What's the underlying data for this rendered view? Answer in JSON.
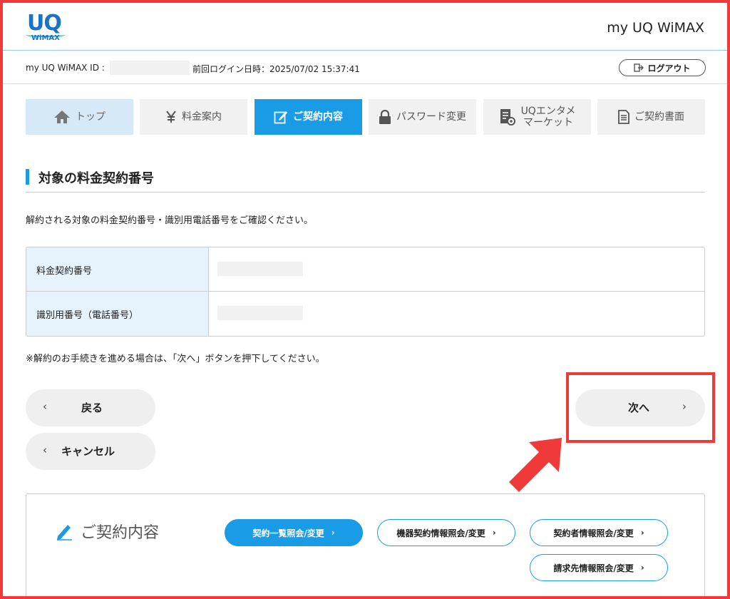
{
  "header": {
    "logo_top": "UQ",
    "logo_bottom": "WiMAX",
    "site_title": "my UQ WiMAX"
  },
  "infobar": {
    "id_label": "my UQ WiMAX ID :",
    "last_login": "前回ログイン日時：2025/07/02 15:37:41",
    "logout_label": "ログアウト"
  },
  "nav": {
    "tabs": [
      {
        "label": "トップ",
        "icon": "home-icon"
      },
      {
        "label": "料金案内",
        "icon": "yen-icon"
      },
      {
        "label": "ご契約内容",
        "icon": "edit-icon"
      },
      {
        "label": "パスワード変更",
        "icon": "lock-icon"
      },
      {
        "label_line1": "UQエンタメ",
        "label_line2": "マーケット",
        "icon": "document-gear-icon"
      },
      {
        "label": "ご契約書面",
        "icon": "document-icon"
      }
    ]
  },
  "section": {
    "title": "対象の料金契約番号",
    "description": "解約される対象の料金契約番号・識別用電話番号をご確認ください。"
  },
  "table": {
    "rows": [
      {
        "label": "料金契約番号"
      },
      {
        "label": "識別用番号（電話番号）"
      }
    ]
  },
  "note": "※解約のお手続きを進める場合は、「次へ」ボタンを押下してください。",
  "buttons": {
    "back": "戻る",
    "cancel": "キャンセル",
    "next": "次へ",
    "chev_left": "‹",
    "chev_right": "›"
  },
  "panel": {
    "title": "ご契約内容",
    "links": [
      "契約一覧照会/変更",
      "機器契約情報照会/変更",
      "契約者情報照会/変更",
      "請求先情報照会/変更"
    ],
    "link_chev": "›"
  },
  "colors": {
    "accent": "#1a9be5",
    "highlight": "#ef3a3a"
  }
}
